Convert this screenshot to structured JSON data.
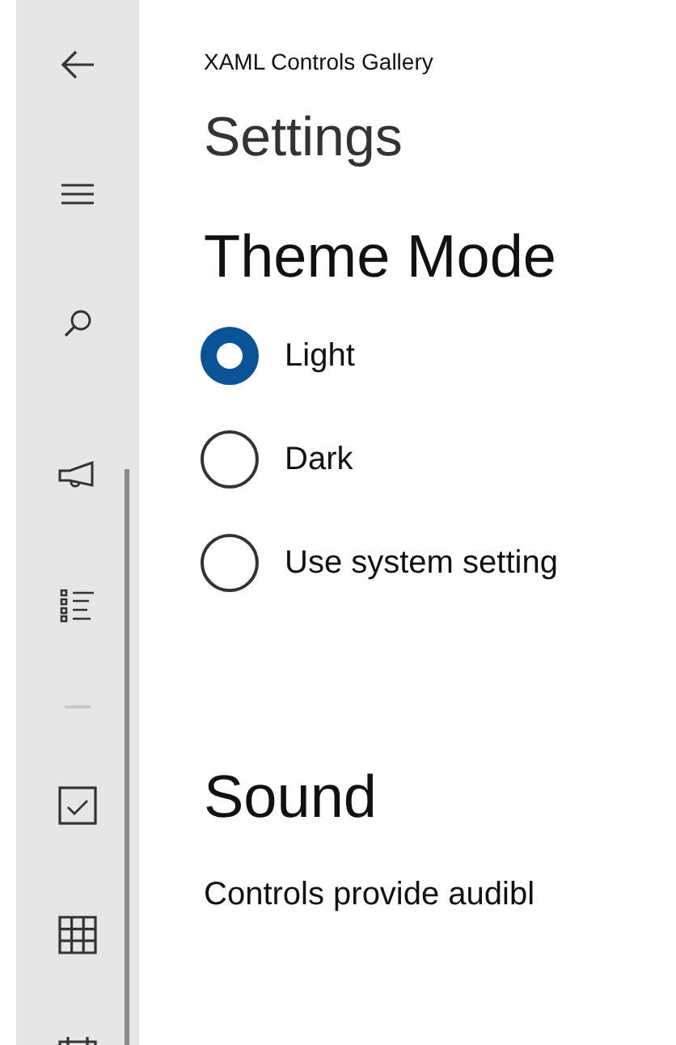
{
  "header": {
    "app_title": "XAML Controls Gallery",
    "page_title": "Settings"
  },
  "theme_section": {
    "heading": "Theme Mode",
    "options": [
      {
        "label": "Light",
        "selected": true
      },
      {
        "label": "Dark",
        "selected": false
      },
      {
        "label": "Use system setting",
        "selected": false
      }
    ]
  },
  "sound_section": {
    "heading": "Sound",
    "description": "Controls provide audibl"
  }
}
